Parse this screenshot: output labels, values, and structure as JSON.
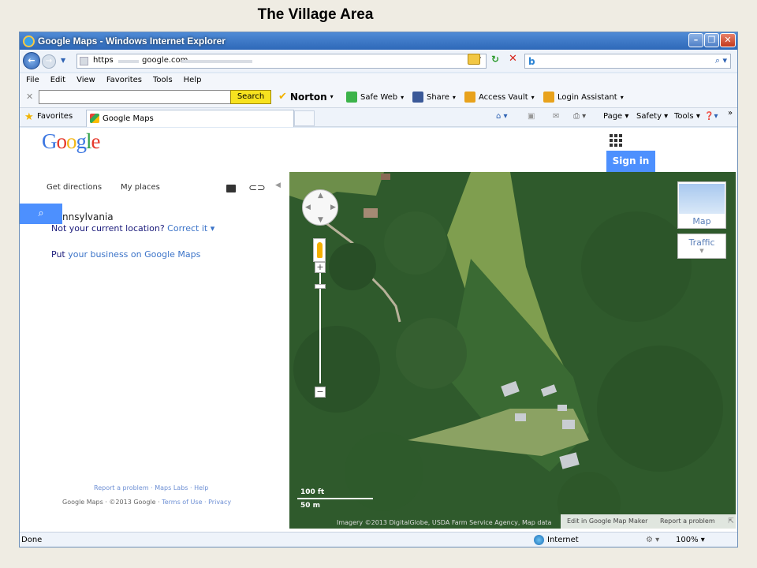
{
  "slide": {
    "title": "The Village Area"
  },
  "window": {
    "title": "Google Maps - Windows Internet Explorer"
  },
  "address": {
    "protocol": "https",
    "domain": "google.com"
  },
  "menus": [
    "File",
    "Edit",
    "View",
    "Favorites",
    "Tools",
    "Help"
  ],
  "norton": {
    "search_label": "Search",
    "brand": "Norton",
    "items": [
      "Safe Web",
      "Share",
      "Access Vault",
      "Login Assistant"
    ]
  },
  "favorites": {
    "label": "Favorites",
    "tab_label": "Google Maps"
  },
  "commands": [
    "Page",
    "Safety",
    "Tools"
  ],
  "google": {
    "logo": "Google",
    "signin": "Sign in",
    "get_directions": "Get directions",
    "my_places": "My places",
    "location": "nnsylvania",
    "not_location": "Not your current location?",
    "correct_it": "Correct it",
    "put_prefix": "Put",
    "put_business": "your business on Google Maps",
    "footer_links": "Report a problem · Maps Labs · Help",
    "copyright_text": "Google Maps · ©2013 Google ·",
    "copyright_links": "Terms of Use · Privacy"
  },
  "map": {
    "map_button": "Map",
    "traffic_button": "Traffic",
    "scale_ft": "100 ft",
    "scale_m": "50 m",
    "credit": "Imagery ©2013 DigitalGlobe, USDA Farm Service Agency, Map data",
    "edit_link": "Edit in Google Map Maker",
    "report_link": "Report a problem"
  },
  "status": {
    "left": "Done",
    "zone": "Internet",
    "zoom": "100%"
  },
  "colors": {
    "accent": "#4d90fe",
    "forest": "#2f5a2c",
    "clearing": "#7f9e4f"
  }
}
